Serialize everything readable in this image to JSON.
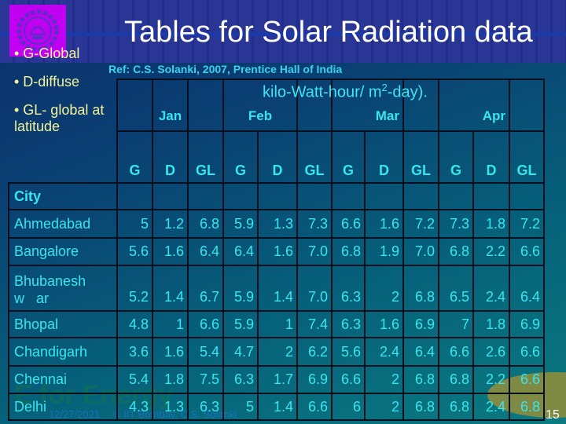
{
  "slide": {
    "title": "Tables for Solar Radiation data",
    "reference": "Ref: C.S. Solanki, 2007, Prentice Hall of India",
    "units_prefix": "kilo-Watt-hour/ m",
    "units_sup": "2",
    "units_suffix": "-day).",
    "legend": [
      "• G-Global",
      "• D-diffuse",
      "• GL- global at",
      "latitude"
    ],
    "footer_date": "12/27/2021",
    "footer_credit": "© IIT Bombay, C.S. Solanki",
    "watermark": "E for Energy",
    "page_number": "15",
    "colors": {
      "title": "#ffffff",
      "legend_text": "#f3f39a",
      "reference_text": "#37d3f0",
      "table_text": "#38e6ee",
      "logo_bg": "#c000f0"
    }
  },
  "table": {
    "city_header": "City",
    "months": [
      "Jan",
      "Feb",
      "Mar",
      "Apr"
    ],
    "subheaders": [
      "G",
      "D",
      "GL",
      "G",
      "D",
      "GL",
      "G",
      "D",
      "GL",
      "G",
      "D",
      "GL"
    ],
    "rows": [
      {
        "city": "Ahmedabad",
        "values": [
          "5",
          "1.2",
          "6.8",
          "5.9",
          "1.3",
          "7.3",
          "6.6",
          "1.6",
          "7.2",
          "7.3",
          "1.8",
          "7.2"
        ]
      },
      {
        "city": "Bangalore",
        "values": [
          "5.6",
          "1.6",
          "6.4",
          "6.4",
          "1.6",
          "7.0",
          "6.8",
          "1.9",
          "7.0",
          "6.8",
          "2.2",
          "6.6"
        ]
      },
      {
        "city": "Bhubaneshw   ar",
        "values": [
          "5.2",
          "1.4",
          "6.7",
          "5.9",
          "1.4",
          "7.0",
          "6.3",
          "2",
          "6.8",
          "6.5",
          "2.4",
          "6.4"
        ]
      },
      {
        "city": "Bhopal",
        "values": [
          "4.8",
          "1",
          "6.6",
          "5.9",
          "1",
          "7.4",
          "6.3",
          "1.6",
          "6.9",
          "7",
          "1.8",
          "6.9"
        ]
      },
      {
        "city": "Chandigarh",
        "values": [
          "3.6",
          "1.6",
          "5.4",
          "4.7",
          "2",
          "6.2",
          "5.6",
          "2.4",
          "6.4",
          "6.6",
          "2.6",
          "6.6"
        ]
      },
      {
        "city": "Chennai",
        "values": [
          "5.4",
          "1.8",
          "7.5",
          "6.3",
          "1.7",
          "6.9",
          "6.6",
          "2",
          "6.8",
          "6.8",
          "2.2",
          "6.6"
        ]
      },
      {
        "city": "Delhi",
        "values": [
          "4.3",
          "1.3",
          "6.3",
          "5",
          "1.4",
          "6.6",
          "6",
          "2",
          "6.8",
          "6.8",
          "2.4",
          "6.8"
        ]
      }
    ]
  }
}
